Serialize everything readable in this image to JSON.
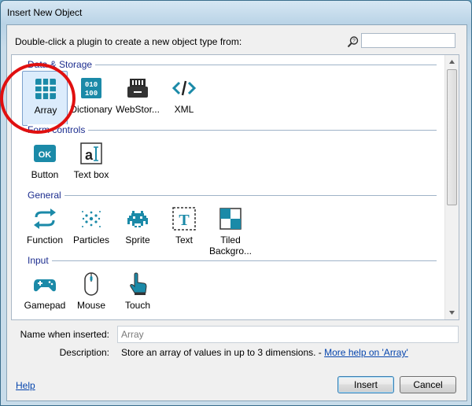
{
  "window": {
    "title": "Insert New Object"
  },
  "header": {
    "instruction": "Double-click a plugin to create a new object type from:",
    "search_placeholder": ""
  },
  "categories": [
    {
      "label": "Data & Storage",
      "items": [
        {
          "label": "Array",
          "icon": "array-grid-icon",
          "selected": true
        },
        {
          "label": "Dictionary",
          "icon": "dictionary-binary-icon"
        },
        {
          "label": "WebStor...",
          "icon": "webstorage-icon"
        },
        {
          "label": "XML",
          "icon": "xml-code-icon"
        }
      ]
    },
    {
      "label": "Form controls",
      "items": [
        {
          "label": "Button",
          "icon": "ok-button-icon"
        },
        {
          "label": "Text box",
          "icon": "textbox-icon"
        }
      ]
    },
    {
      "label": "General",
      "items": [
        {
          "label": "Function",
          "icon": "function-arrows-icon"
        },
        {
          "label": "Particles",
          "icon": "particles-icon"
        },
        {
          "label": "Sprite",
          "icon": "sprite-invader-icon"
        },
        {
          "label": "Text",
          "icon": "text-t-icon"
        },
        {
          "label": "Tiled",
          "label2": "Backgro...",
          "icon": "tiled-background-icon"
        }
      ]
    },
    {
      "label": "Input",
      "items": [
        {
          "label": "Gamepad",
          "icon": "gamepad-icon"
        },
        {
          "label": "Mouse",
          "icon": "mouse-icon"
        },
        {
          "label": "Touch",
          "icon": "touch-hand-icon"
        }
      ]
    }
  ],
  "footer": {
    "name_label": "Name when inserted:",
    "name_value": "Array",
    "description_label": "Description:",
    "description_text": "Store an array of values in up to 3 dimensions. - ",
    "description_link": "More help on 'Array'",
    "help_label": "Help",
    "insert_label": "Insert",
    "cancel_label": "Cancel"
  },
  "colors": {
    "icon_teal": "#1b8aa8",
    "highlight_circle": "#e01010",
    "category_text": "#1c2d8f",
    "link": "#0645ad"
  }
}
